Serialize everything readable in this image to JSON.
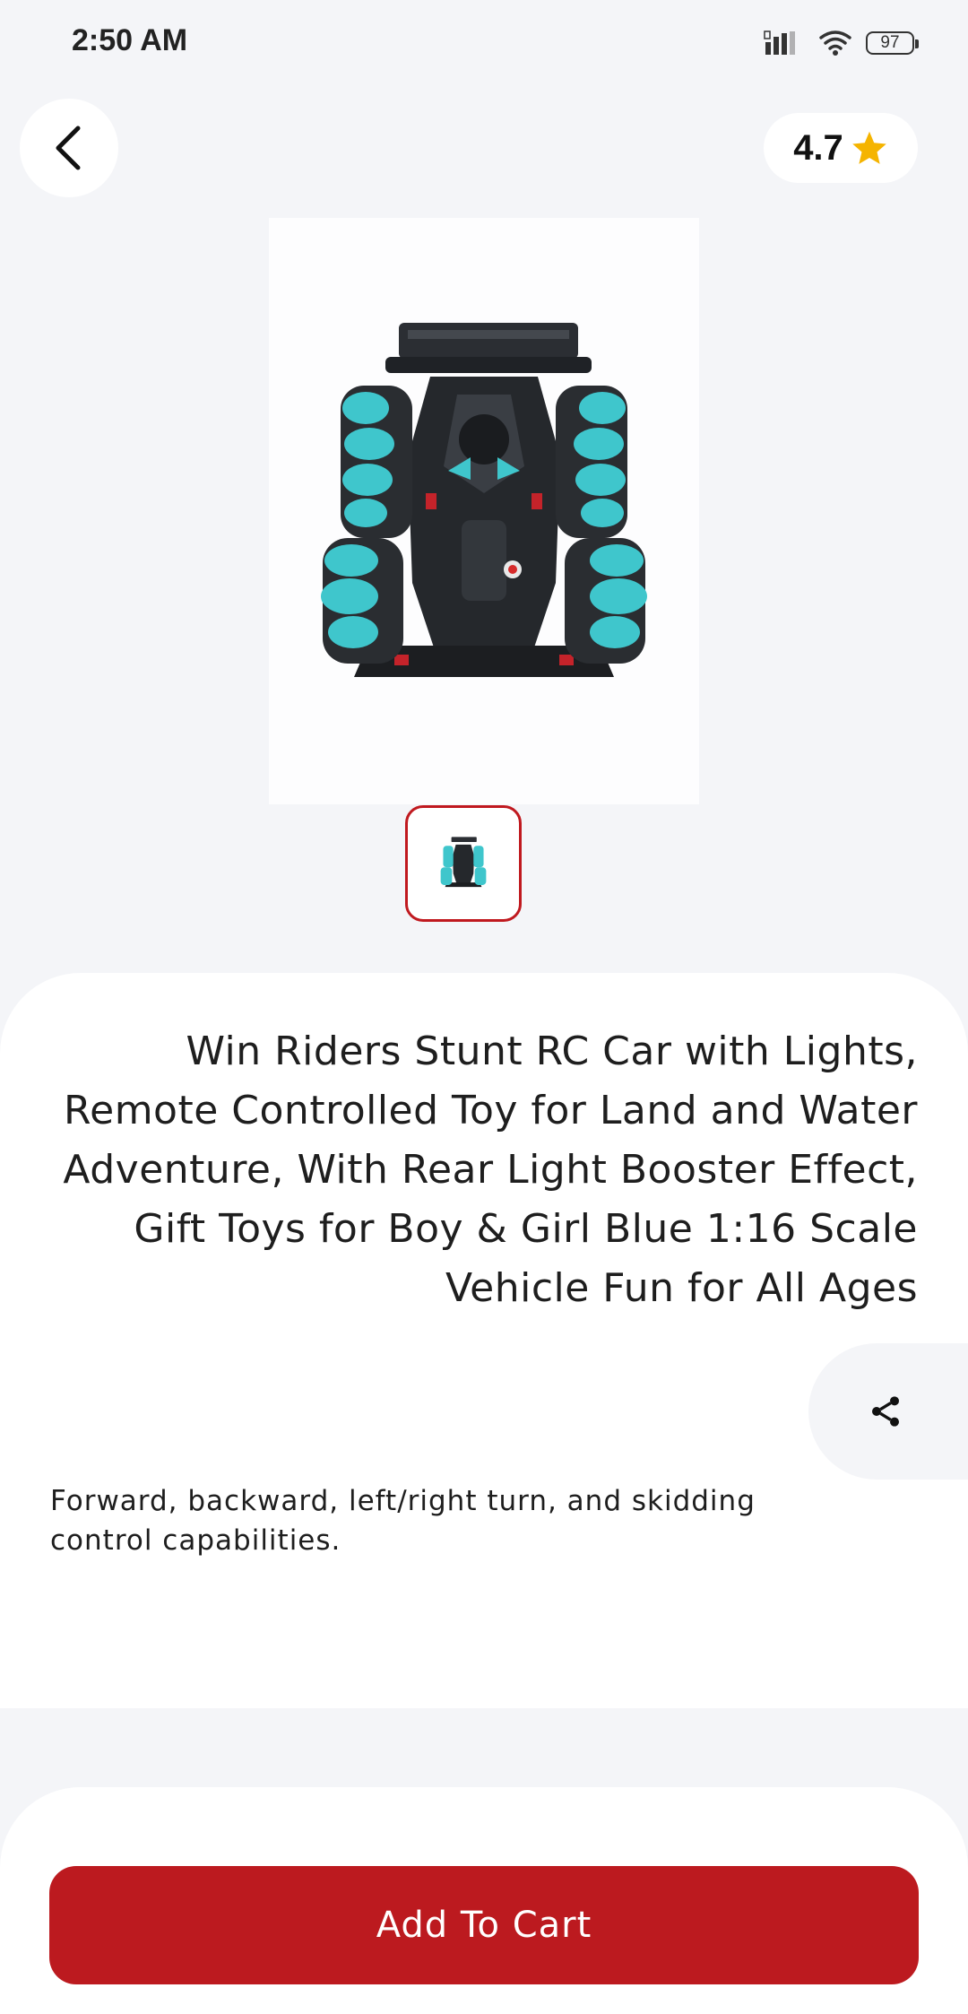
{
  "status_bar": {
    "time": "2:50 AM",
    "battery": "97",
    "icons": [
      "signal-icon",
      "wifi-icon",
      "battery-icon"
    ]
  },
  "header": {
    "back_icon": "chevron-left-icon",
    "rating": "4.7",
    "rating_icon": "star-icon"
  },
  "product": {
    "image": "rc-stunt-car-image",
    "thumbnails": [
      "rc-stunt-car-thumbnail"
    ],
    "title": "Win Riders Stunt RC Car with Lights, Remote Controlled Toy for Land and Water Adventure, With Rear Light Booster Effect, Gift Toys for Boy & Girl Blue 1:16 Scale Vehicle Fun for All Ages",
    "description": "Forward, backward, left/right turn, and skidding control capabilities.",
    "share_icon": "share-icon"
  },
  "actions": {
    "add_to_cart_label": "Add To Cart"
  },
  "colors": {
    "accent": "#bc1a1f",
    "star": "#f5b400",
    "background": "#f4f5f8",
    "card": "#ffffff"
  }
}
